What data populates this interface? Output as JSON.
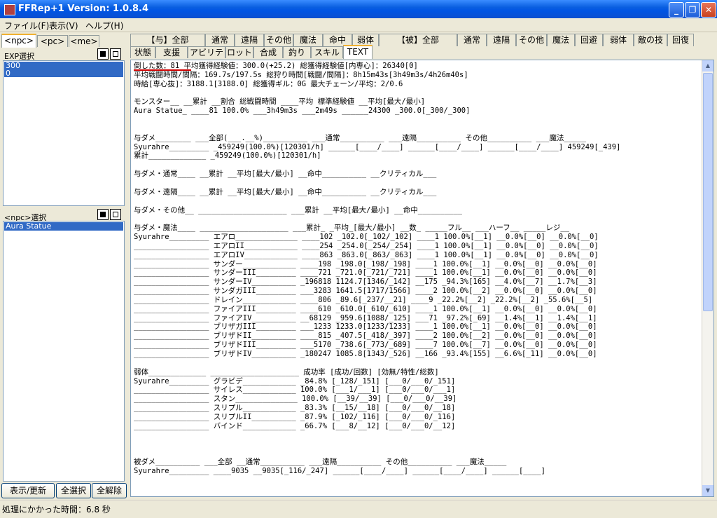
{
  "window": {
    "title": "FFRep+1 Version: 1.0.8.4"
  },
  "menu": [
    "ファイル(F)",
    "表示(V)",
    "ヘルプ(H)"
  ],
  "left": {
    "tabs": [
      "<npc>",
      "<pc>",
      "<me>"
    ],
    "exp_label": "EXP選択",
    "exp_items": [
      "300",
      "0"
    ],
    "npc_label": "<npc>選択",
    "npc_items": [
      "Aura Statue"
    ],
    "buttons": [
      "表示/更新",
      "全選択",
      "全解除"
    ]
  },
  "tabs_row1": [
    "【与】全部",
    "通常",
    "遠隔",
    "その他",
    "魔法",
    "命中",
    "弱体",
    "【被】全部",
    "通常",
    "遠隔",
    "その他",
    "魔法",
    "回避",
    "弱体",
    "敵の技",
    "回復"
  ],
  "tabs_row2": [
    "状態",
    "支援",
    "アビリティ",
    "ロット",
    "合成",
    "釣り",
    "スキル",
    "TEXT"
  ],
  "text_lines": [
    "倒した数：81 平均獲得経験値：300.0(+25.2) 総獲得経験値[内専心]：26340[0]",
    "平均戦闘時間/間隔：169.7s/197.5s 総狩り時間[戦闘/間隔]：8h15m43s[3h49m3s/4h26m40s]",
    "時給[専心抜]：3188.1[3188.0] 総獲得ギル：0G 最大チェーン/平均：2/0.6",
    "",
    "モンスター__ __累計 __割合 総戦闘時間 ____平均 標準経験値 __平均[最大/最小]",
    "Aura Statue_ ____81 100.0% ___3h49m3s ___2m49s ______24300 _300.0[_300/_300]",
    "",
    "",
    "与ダメ________ ___全部(___.__%)__________ ___通常__________ ___遠隔__________ その他__________ ___魔法_____",
    "Syurahre_________ _459249(100.0%)[120301/h] ______[____/____] ______[____/____] ______[____/____] 459249[_439]",
    "累計_____________ _459249(100.0%)[120301/h]",
    "",
    "与ダメ・通常____ __累計 __平均[最大/最小] __命中__________ __クリティカル___",
    "",
    "与ダメ・遠隔____ __累計 __平均[最大/最小] __命中__________ __クリティカル___",
    "",
    "与ダメ・その他__ ____________________ ___累計 __平均[最大/最小] __命中__________",
    "",
    "与ダメ・魔法____ ____________________ ___累計_ _平均_[最大/最小] __数_ _____フル__ ___ハーフ__ _____レジ__",
    "Syurahre_________ エアロ______________ ____102 _102.0[_102/_102] ____1 100.0%[__1] __0.0%[__0] __0.0%[__0]",
    "_________________ エアロII____________ ____254 _254.0[_254/_254] ____1 100.0%[__1] __0.0%[__0] __0.0%[__0]",
    "_________________ エアロIV____________ ____863 _863.0[_863/_863] ____1 100.0%[__1] __0.0%[__0] __0.0%[__0]",
    "_________________ サンダー____________ ____198 _198.0[_198/_198] ____1 100.0%[__1] __0.0%[__0] __0.0%[__0]",
    "_________________ サンダーIII_________ ____721 _721.0[_721/_721] ____1 100.0%[__1] __0.0%[__0] __0.0%[__0]",
    "_________________ サンダーIV__________ _196818 1124.7[1346/_142] __175 _94.3%[165] __4.0%[__7] __1.7%[__3]",
    "_________________ サンダガIII_________ ___3283 1641.5[1717/1566] ____2 100.0%[__2] __0.0%[__0] __0.0%[__0]",
    "_________________ ドレイン____________ ____806 _89.6[_237/__21] ____9 _22.2%[__2] _22.2%[__2] _55.6%[__5]",
    "_________________ ファイアIII_________ ____610 _610.0[_610/_610] ____1 100.0%[__1] __0.0%[__0] __0.0%[__0]",
    "_________________ ファイアIV__________ __68129 _959.6[1088/_125] ___71 _97.2%[_69] __1.4%[__1] __1.4%[__1]",
    "_________________ ブリザガIII_________ ___1233 1233.0[1233/1233] ____1 100.0%[__1] __0.0%[__0] __0.0%[__0]",
    "_________________ ブリザドII__________ ____815 _407.5[_418/_397] ____2 100.0%[__2] __0.0%[__0] __0.0%[__0]",
    "_________________ ブリザドIII_________ ___5170 _738.6[_773/_689] ____7 100.0%[__7] __0.0%[__0] __0.0%[__0]",
    "_________________ ブリザドIV__________ _180247 1085.8[1343/_526] __166 _93.4%[155] __6.6%[_11] __0.0%[__0]",
    "",
    "弱体_____________ ____________________ 成功率 [成功/回数] [効無/特性/総数]",
    "Syurahre_________ グラビデ____________ _84.8% [_128/_151] [___0/___0/_151]",
    "_________________ サイレス____________ 100.0% [___1/___1] [___0/___0/___1]",
    "_________________ スタン______________ 100.0% [__39/__39] [___0/___0/__39]",
    "_________________ スリプル____________ _83.3% [__15/__18] [___0/___0/__18]",
    "_________________ スリプルII__________ _87.9% [_102/_116] [___0/___0/_116]",
    "_________________ バインド____________ _66.7% [___8/__12] [___0/___0/__12]",
    "",
    "",
    "",
    "被ダメ__________ ___全部 __通常__________ ___遠隔__________ その他__________ ___魔法_____",
    "Syurahre_________ ____9035 __9035[_116/_247] ______[____/____] ______[____/____] ______[____]"
  ],
  "status": "処理にかかった時間：6.8 秒"
}
